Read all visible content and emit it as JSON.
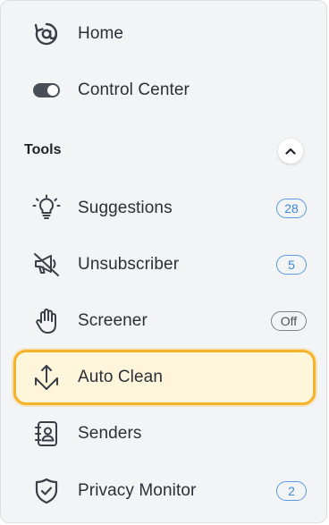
{
  "nav": {
    "home": {
      "label": "Home",
      "icon": "at-sync-icon"
    },
    "control_center": {
      "label": "Control Center",
      "icon": "toggle-icon"
    }
  },
  "tools": {
    "title": "Tools",
    "collapse_icon": "chevron-up-icon",
    "items": [
      {
        "label": "Suggestions",
        "icon": "lightbulb-icon",
        "badge": "28"
      },
      {
        "label": "Unsubscriber",
        "icon": "muted-megaphone-icon",
        "badge": "5"
      },
      {
        "label": "Screener",
        "icon": "hand-icon",
        "badge": "Off"
      },
      {
        "label": "Auto Clean",
        "icon": "sweep-arrows-icon",
        "badge": "",
        "active": true
      },
      {
        "label": "Senders",
        "icon": "contacts-book-icon",
        "badge": ""
      },
      {
        "label": "Privacy Monitor",
        "icon": "shield-check-icon",
        "badge": "2"
      }
    ]
  },
  "colors": {
    "accent_badge": "#3f86dd",
    "active_border": "#f6b32a",
    "active_fill": "#fff6dc",
    "panel_bg": "#f3f4f6"
  }
}
